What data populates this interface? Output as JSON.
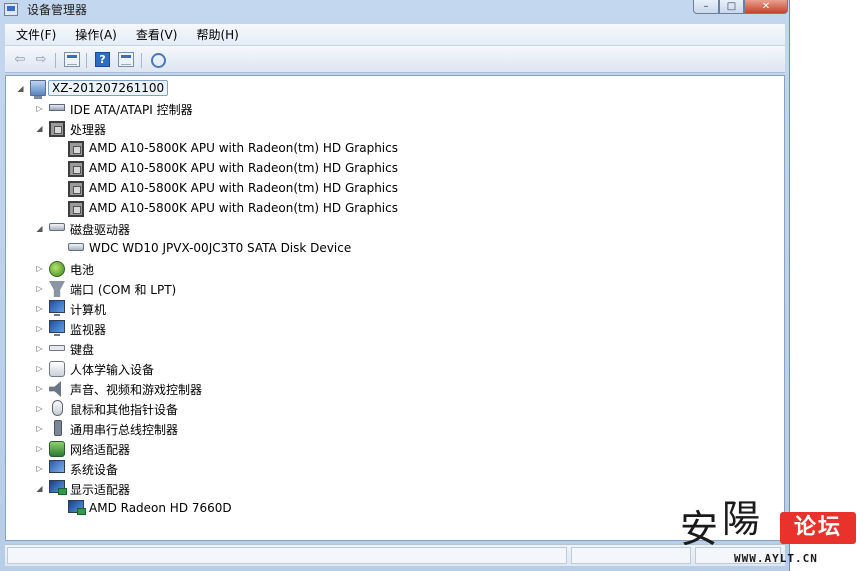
{
  "window": {
    "title": "设备管理器",
    "controls": {
      "minimize": "–",
      "maximize": "□",
      "close": "✕"
    }
  },
  "menubar": {
    "items": [
      "文件(F)",
      "操作(A)",
      "查看(V)",
      "帮助(H)"
    ]
  },
  "toolbar": {
    "back_icon": "back-arrow-icon",
    "forward_icon": "forward-arrow-icon",
    "back_glyph": "⇦",
    "forward_glyph": "⇨",
    "help_glyph": "?"
  },
  "tree": {
    "root": "XZ-201207261100",
    "categories": {
      "ide": "IDE ATA/ATAPI 控制器",
      "processors": "处理器",
      "cpu1": "AMD A10-5800K APU with Radeon(tm) HD Graphics",
      "cpu2": "AMD A10-5800K APU with Radeon(tm) HD Graphics",
      "cpu3": "AMD A10-5800K APU with Radeon(tm) HD Graphics",
      "cpu4": "AMD A10-5800K APU with Radeon(tm) HD Graphics",
      "disks": "磁盘驱动器",
      "disk1": "WDC WD10 JPVX-00JC3T0 SATA Disk Device",
      "battery": "电池",
      "ports": "端口 (COM 和 LPT)",
      "computer": "计算机",
      "monitors": "监视器",
      "keyboard": "键盘",
      "hid": "人体学输入设备",
      "sound": "声音、视频和游戏控制器",
      "mice": "鼠标和其他指针设备",
      "usb": "通用串行总线控制器",
      "network": "网络适配器",
      "system": "系统设备",
      "display": "显示适配器",
      "gpu1": "AMD Radeon HD 7660D"
    },
    "expander_collapsed": "▷",
    "expander_expanded": "◢"
  },
  "watermark": {
    "chars": [
      "安",
      "陽"
    ],
    "badge": "论坛",
    "url": "WWW.AYLT.CN"
  }
}
